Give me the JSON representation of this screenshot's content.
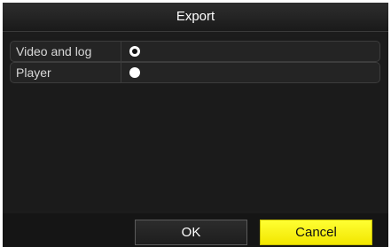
{
  "dialog": {
    "title": "Export"
  },
  "options": [
    {
      "label": "Video and log",
      "selected": true
    },
    {
      "label": "Player",
      "selected": false
    }
  ],
  "buttons": {
    "ok_label": "OK",
    "cancel_label": "Cancel"
  },
  "colors": {
    "cancel_accent": "#ffff00",
    "background": "#1c1c1c"
  }
}
